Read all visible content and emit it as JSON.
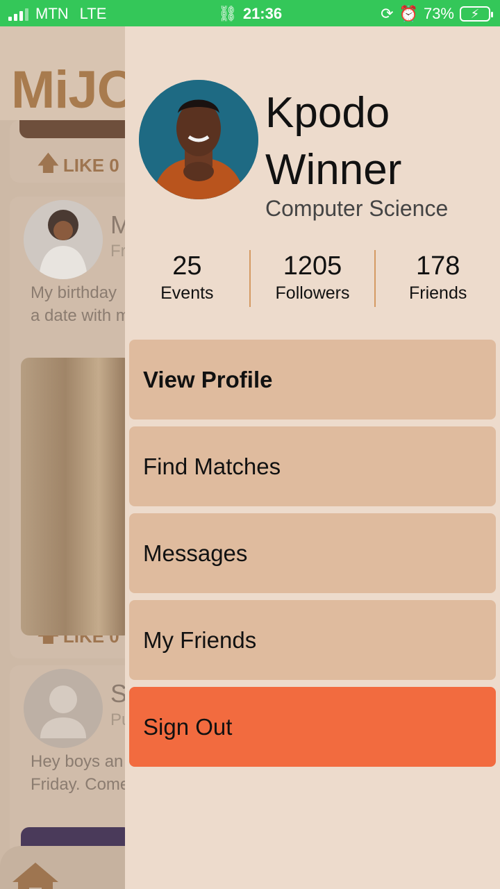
{
  "status_bar": {
    "carrier": "MTN",
    "network": "LTE",
    "time": "21:36",
    "battery": "73%"
  },
  "feed": {
    "logo": "MiJO",
    "posts": [
      {
        "like_label": "LIKE 0"
      },
      {
        "name": "Ma",
        "subtitle": "Frie",
        "text_line1": "My birthday",
        "text_line2": "a date with m",
        "like_label": "LIKE 0"
      },
      {
        "name": "Sa",
        "subtitle": "Pub",
        "text_line1": "Hey boys an",
        "text_line2": "Friday. Come"
      }
    ]
  },
  "drawer": {
    "name": "Kpodo Winner",
    "department": "Computer Science",
    "stats": [
      {
        "value": "25",
        "label": "Events"
      },
      {
        "value": "1205",
        "label": "Followers"
      },
      {
        "value": "178",
        "label": "Friends"
      }
    ],
    "menu": [
      {
        "label": "View Profile"
      },
      {
        "label": "Find Matches"
      },
      {
        "label": "Messages"
      },
      {
        "label": "My Friends"
      },
      {
        "label": "Sign Out"
      }
    ]
  },
  "colors": {
    "status_bar": "#34c759",
    "drawer_bg": "#eddbcc",
    "menu_item": "#dfbb9e",
    "sign_out": "#f26b3f",
    "stat_divider": "#d59a62"
  }
}
